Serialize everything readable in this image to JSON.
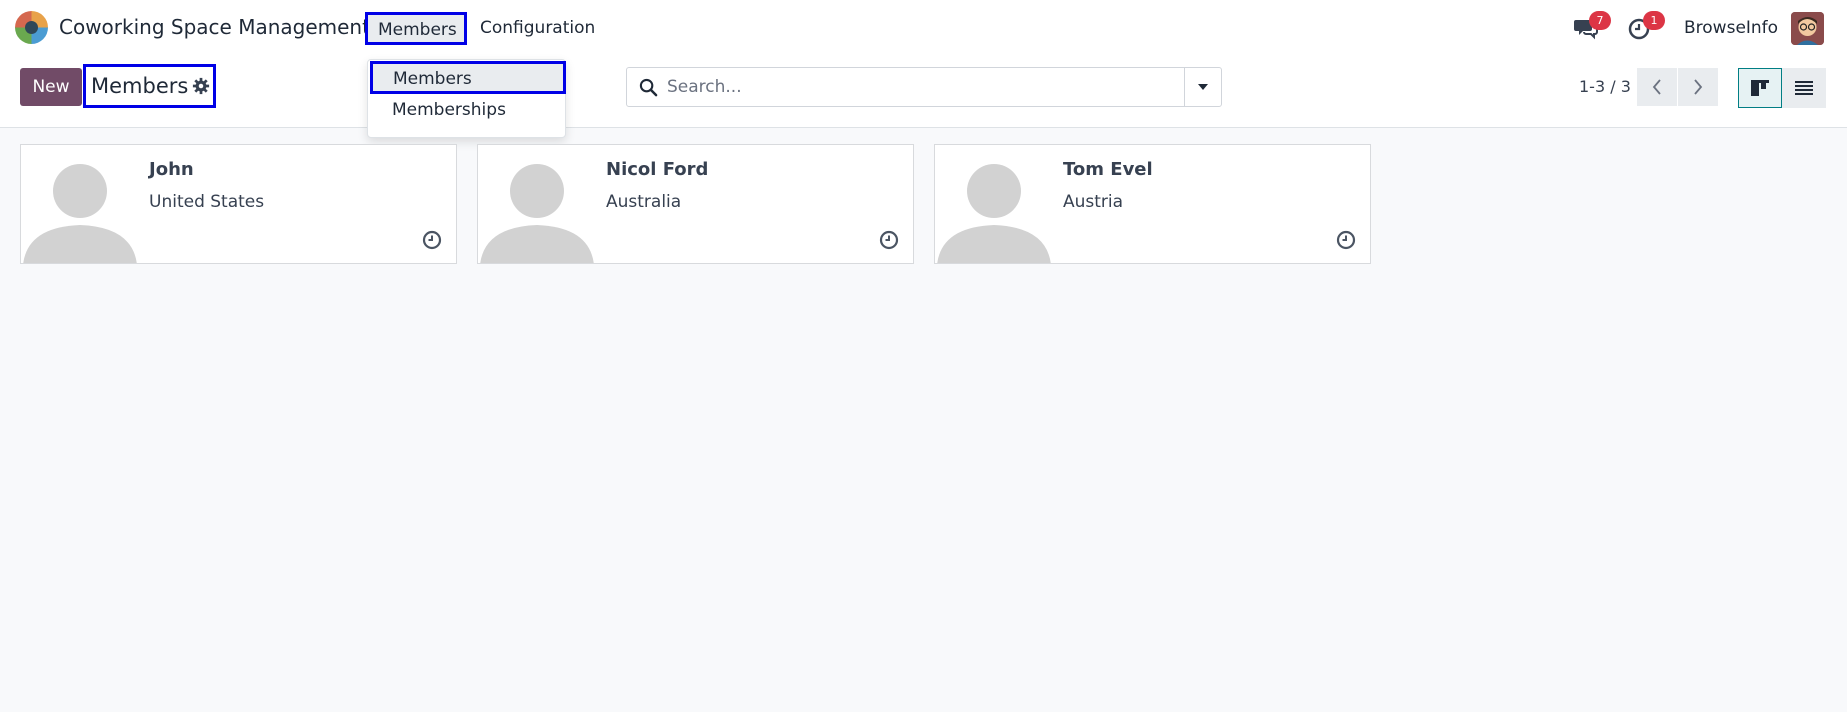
{
  "navbar": {
    "app_name": "Coworking Space Management",
    "menus": {
      "members": "Members",
      "configuration": "Configuration"
    },
    "messages_count": "7",
    "activities_count": "1",
    "user_name": "BrowseInfo"
  },
  "control_panel": {
    "new_label": "New",
    "title": "Members",
    "search_placeholder": "Search...",
    "pager": "1-3 / 3"
  },
  "dropdown": {
    "items": [
      "Members",
      "Memberships"
    ]
  },
  "cards": [
    {
      "name": "John",
      "country": "United States"
    },
    {
      "name": "Nicol Ford",
      "country": "Australia"
    },
    {
      "name": "Tom Evel",
      "country": "Austria"
    }
  ],
  "colors": {
    "brand": "#714b67",
    "highlight": "#0000e6",
    "badge": "#dc3545"
  }
}
